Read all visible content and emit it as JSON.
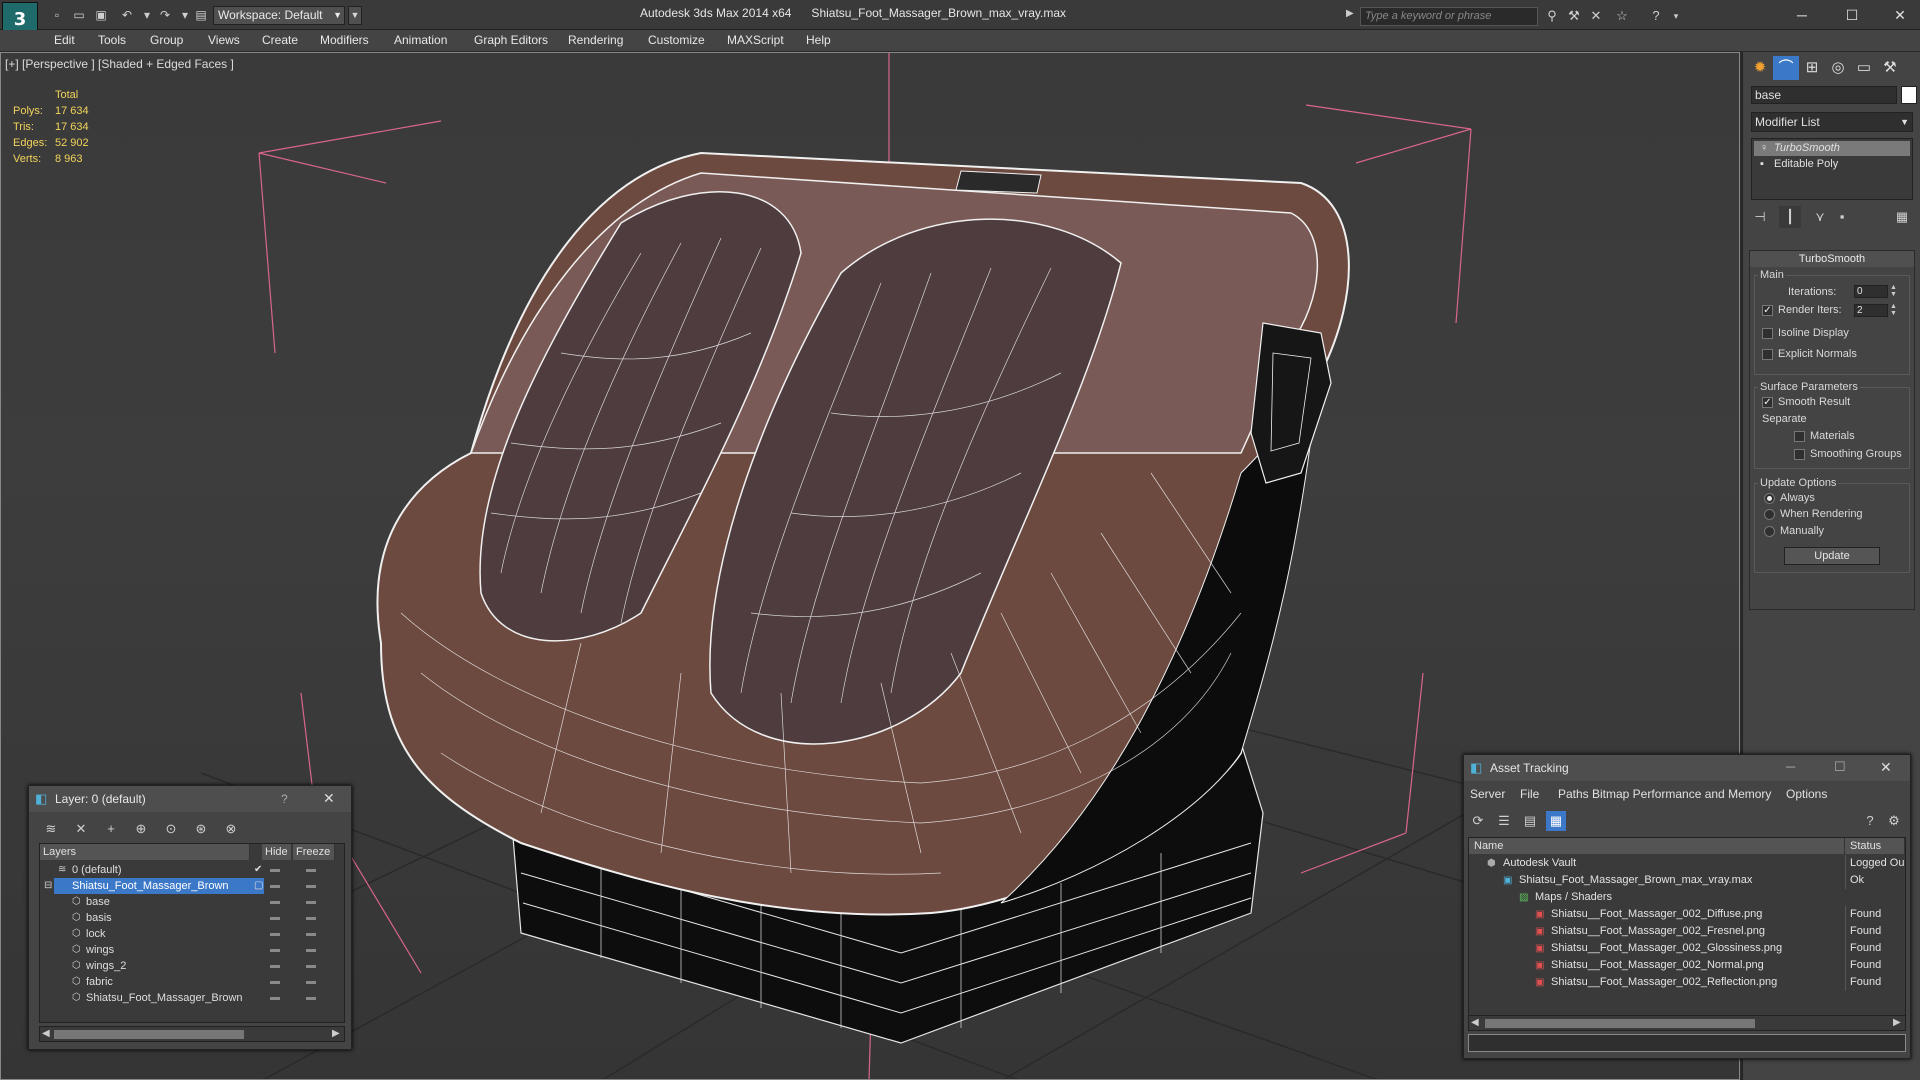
{
  "titlebar": {
    "workspace": "Workspace: Default",
    "app_title": "Autodesk 3ds Max 2014 x64      Shiatsu_Foot_Massager_Brown_max_vray.max",
    "search_placeholder": "Type a keyword or phrase"
  },
  "menu": [
    "Edit",
    "Tools",
    "Group",
    "Views",
    "Create",
    "Modifiers",
    "Animation",
    "Graph Editors",
    "Rendering",
    "Customize",
    "MAXScript",
    "Help"
  ],
  "viewport": {
    "label": "[+] [Perspective ] [Shaded + Edged Faces ]",
    "stats": {
      "header": "Total",
      "rows": [
        {
          "k": "Polys:",
          "v": "17 634"
        },
        {
          "k": "Tris:",
          "v": "17 634"
        },
        {
          "k": "Edges:",
          "v": "52 902"
        },
        {
          "k": "Verts:",
          "v": "8 963"
        }
      ]
    }
  },
  "command_panel": {
    "object_name": "base",
    "modifier_list": "Modifier List",
    "stack": [
      "TurboSmooth",
      "Editable Poly"
    ],
    "rollout_title": "TurboSmooth",
    "main_group": "Main",
    "iterations_label": "Iterations:",
    "iterations_value": "0",
    "render_iters_label": "Render Iters:",
    "render_iters_value": "2",
    "isoline_label": "Isoline Display",
    "explicit_normals_label": "Explicit Normals",
    "surface_group": "Surface Parameters",
    "smooth_result_label": "Smooth Result",
    "separate_label": "Separate",
    "materials_label": "Materials",
    "smoothing_groups_label": "Smoothing Groups",
    "update_group": "Update Options",
    "always_label": "Always",
    "when_rendering_label": "When Rendering",
    "manually_label": "Manually",
    "update_button": "Update"
  },
  "layer_window": {
    "title": "Layer: 0 (default)",
    "help": "?",
    "col_layers": "Layers",
    "col_hide": "Hide",
    "col_freeze": "Freeze",
    "rows": [
      {
        "name": "0 (default)",
        "indent": 0
      },
      {
        "name": "Shiatsu_Foot_Massager_Brown",
        "indent": 0
      },
      {
        "name": "base",
        "indent": 1
      },
      {
        "name": "basis",
        "indent": 1
      },
      {
        "name": "lock",
        "indent": 1
      },
      {
        "name": "wings",
        "indent": 1
      },
      {
        "name": "wings_2",
        "indent": 1
      },
      {
        "name": "fabric",
        "indent": 1
      },
      {
        "name": "Shiatsu_Foot_Massager_Brown",
        "indent": 1
      }
    ]
  },
  "asset_window": {
    "title": "Asset Tracking",
    "menu": [
      "Server",
      "File",
      "Paths",
      "Bitmap Performance and Memory",
      "Options"
    ],
    "col_name": "Name",
    "col_status": "Status",
    "rows": [
      {
        "name": "Autodesk Vault",
        "status": "Logged Ou"
      },
      {
        "name": "Shiatsu_Foot_Massager_Brown_max_vray.max",
        "status": "Ok"
      },
      {
        "name": "Maps / Shaders",
        "status": ""
      },
      {
        "name": "Shiatsu__Foot_Massager_002_Diffuse.png",
        "status": "Found"
      },
      {
        "name": "Shiatsu__Foot_Massager_002_Fresnel.png",
        "status": "Found"
      },
      {
        "name": "Shiatsu__Foot_Massager_002_Glossiness.png",
        "status": "Found"
      },
      {
        "name": "Shiatsu__Foot_Massager_002_Normal.png",
        "status": "Found"
      },
      {
        "name": "Shiatsu__Foot_Massager_002_Reflection.png",
        "status": "Found"
      }
    ]
  },
  "colors": {
    "accent": "#3c78c8",
    "stats_text": "#f2d35b",
    "model_leather": "#8a5a48",
    "model_fabric": "#6b5658"
  }
}
